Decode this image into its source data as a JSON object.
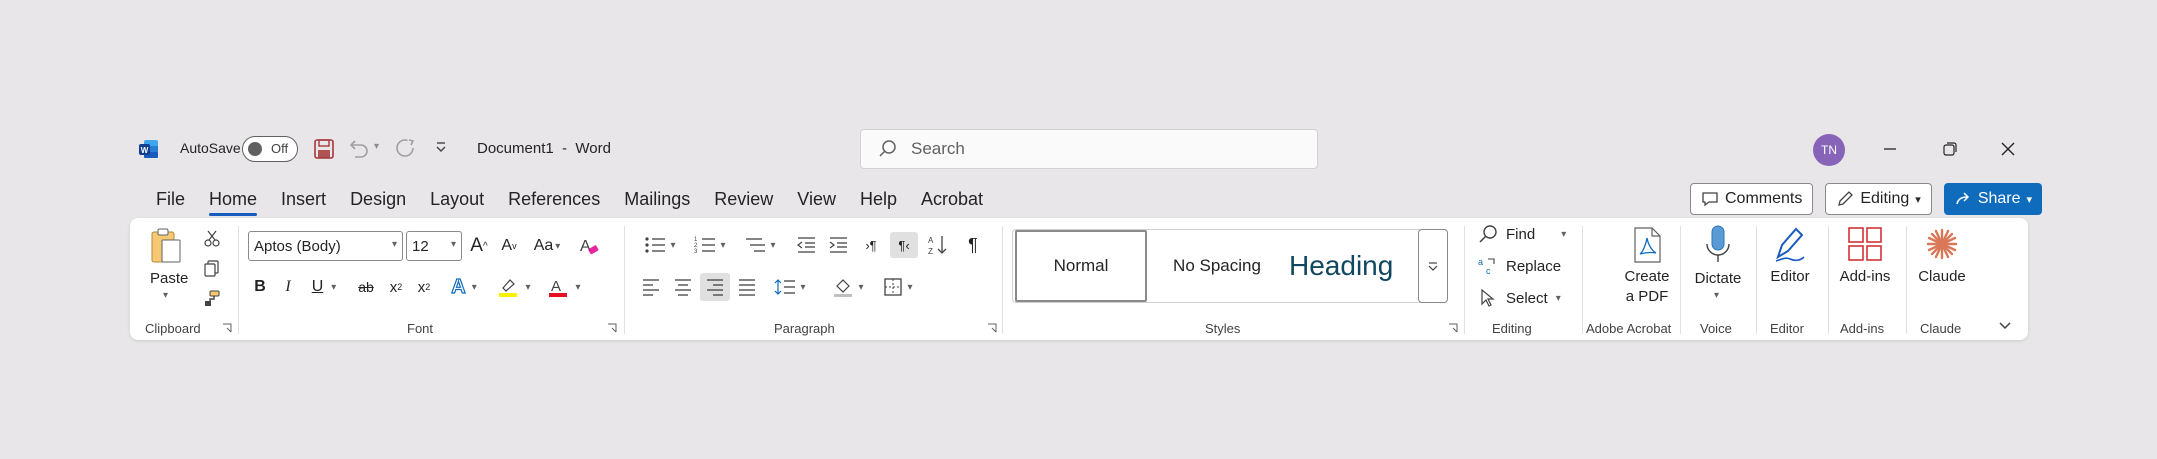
{
  "titlebar": {
    "autosave_label": "AutoSave",
    "autosave_state": "Off",
    "document_title": "Document1  -  Word",
    "search_placeholder": "Search",
    "user_initials": "TN"
  },
  "menu": {
    "tabs": [
      "File",
      "Home",
      "Insert",
      "Design",
      "Layout",
      "References",
      "Mailings",
      "Review",
      "View",
      "Help",
      "Acrobat"
    ],
    "active_tab": "Home",
    "comments_label": "Comments",
    "editing_label": "Editing",
    "share_label": "Share"
  },
  "ribbon": {
    "clipboard": {
      "paste_label": "Paste",
      "group_label": "Clipboard"
    },
    "font": {
      "font_name": "Aptos (Body)",
      "font_size": "12",
      "group_label": "Font"
    },
    "paragraph": {
      "group_label": "Paragraph"
    },
    "styles": {
      "items": [
        "Normal",
        "No Spacing",
        "Heading"
      ],
      "group_label": "Styles"
    },
    "editing": {
      "find_label": "Find",
      "replace_label": "Replace",
      "select_label": "Select",
      "group_label": "Editing"
    },
    "adobe": {
      "create_pdf_line1": "Create",
      "create_pdf_line2": "a PDF",
      "group_label": "Adobe Acrobat"
    },
    "voice": {
      "dictate_label": "Dictate",
      "group_label": "Voice"
    },
    "editor": {
      "editor_label": "Editor",
      "group_label": "Editor"
    },
    "addins": {
      "addins_label": "Add-ins",
      "group_label": "Add-ins"
    },
    "claude": {
      "claude_label": "Claude",
      "group_label": "Claude"
    }
  },
  "colors": {
    "accent": "#185abd",
    "share_bg": "#0f6cbd",
    "avatar_bg": "#8764b8",
    "highlight_yellow": "#ffef00",
    "font_color_red": "#e81123",
    "claude_orange": "#d97757"
  }
}
